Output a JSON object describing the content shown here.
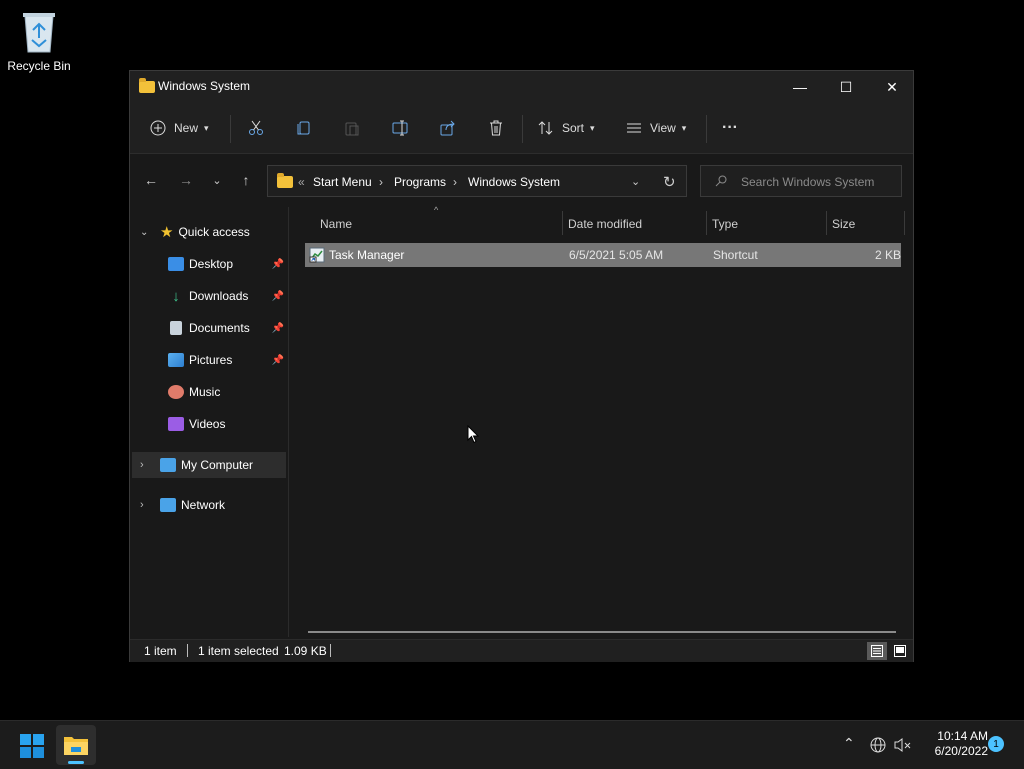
{
  "desktop": {
    "recycle_bin_label": "Recycle Bin"
  },
  "window": {
    "title": "Windows System",
    "controls": {
      "minimize": "—",
      "maximize": "☐",
      "close": "✕"
    },
    "toolbar": {
      "new_label": "New",
      "sort_label": "Sort",
      "view_label": "View",
      "more_label": "···"
    },
    "address": {
      "overflow": "«",
      "crumbs": [
        "Start Menu",
        "Programs",
        "Windows System"
      ]
    },
    "search": {
      "placeholder": "Search Windows System"
    },
    "navpane": {
      "quick_access": "Quick access",
      "items": [
        {
          "label": "Desktop",
          "icon": "desktop-icon",
          "pinned": true
        },
        {
          "label": "Downloads",
          "icon": "download-icon",
          "pinned": true
        },
        {
          "label": "Documents",
          "icon": "documents-icon",
          "pinned": true
        },
        {
          "label": "Pictures",
          "icon": "pictures-icon",
          "pinned": true
        },
        {
          "label": "Music",
          "icon": "music-icon",
          "pinned": false
        },
        {
          "label": "Videos",
          "icon": "videos-icon",
          "pinned": false
        }
      ],
      "my_computer": "My Computer",
      "network": "Network"
    },
    "columns": {
      "name": "Name",
      "date": "Date modified",
      "type": "Type",
      "size": "Size"
    },
    "files": [
      {
        "name": "Task Manager",
        "date": "6/5/2021 5:05 AM",
        "type": "Shortcut",
        "size": "2 KB",
        "selected": true
      }
    ],
    "status": {
      "count": "1 item",
      "selected": "1 item selected",
      "size": "1.09 KB"
    }
  },
  "taskbar": {
    "time": "10:14 AM",
    "date": "6/20/2022",
    "notification_count": "1"
  },
  "colors": {
    "accent": "#0078d4",
    "selection": "#777777",
    "folder": "#f3c13a"
  }
}
